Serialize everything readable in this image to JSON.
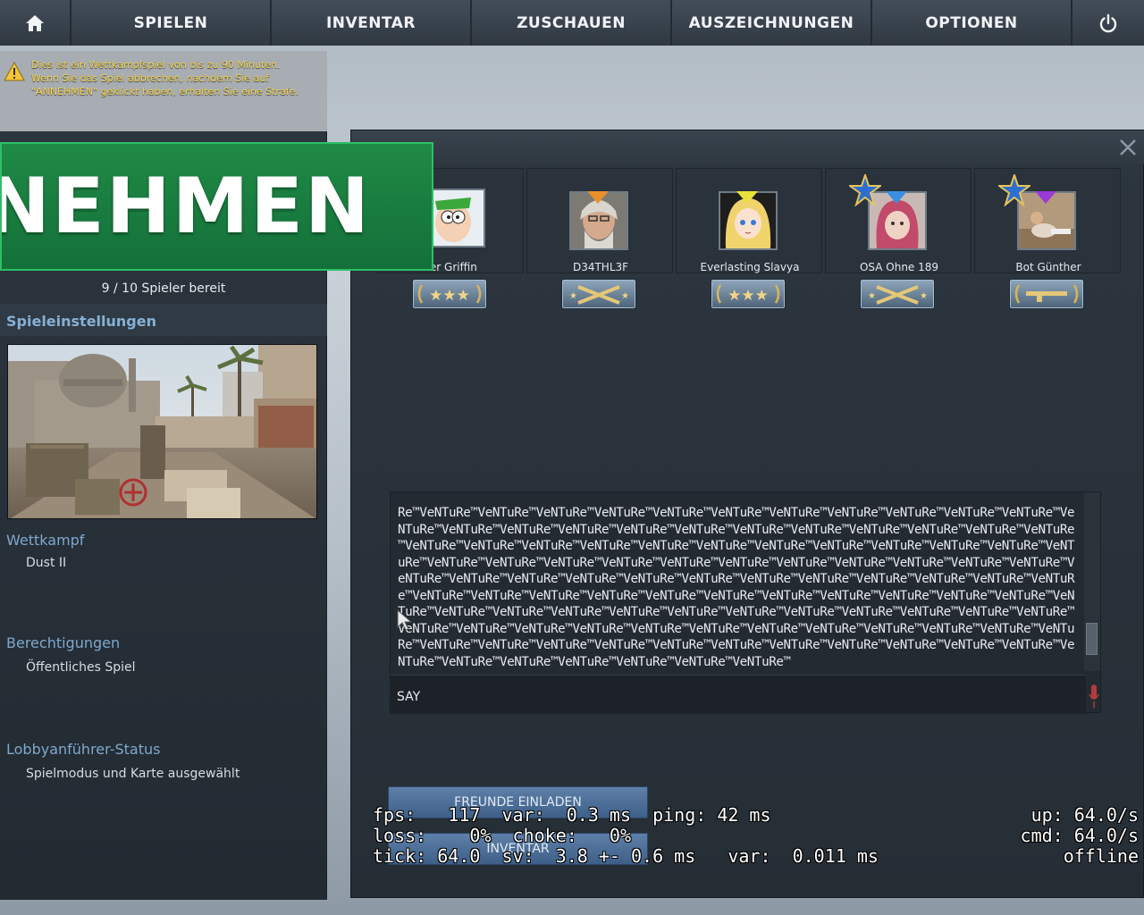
{
  "nav": {
    "tabs": [
      "SPIELEN",
      "INVENTAR",
      "ZUSCHAUEN",
      "AUSZEICHNUNGEN",
      "OPTIONEN"
    ]
  },
  "warning": {
    "text": "Dies ist ein Wettkampfspiel von bis zu 90 Minuten.\nWenn Sie das Spiel abbrechen, nachdem Sie auf\n\"ANNEHMEN\" geklickt haben, erhalten Sie eine Strafe."
  },
  "accept_label": "ANNEHMEN",
  "ready_count": "9 / 10 Spieler bereit",
  "left": {
    "settings_title": "Spieleinstellungen",
    "mode_title": "Wettkampf",
    "map_name": "Dust II",
    "permissions_title": "Berechtigungen",
    "permissions_value": "Öffentliches Spiel",
    "leader_title": "Lobbyanführer-Status",
    "leader_value": "Spielmodus und Karte ausgewählt"
  },
  "players": [
    {
      "name": "ter Griffin"
    },
    {
      "name": "D34THL3F"
    },
    {
      "name": "Everlasting Slavya"
    },
    {
      "name": "OSA Ohne 189"
    },
    {
      "name": "Bot Günther"
    }
  ],
  "chat": {
    "text": "Re™VeNTuRe™VeNTuRe™VeNTuRe™VeNTuRe™VeNTuRe™VeNTuRe™VeNTuRe™VeNTuRe™VeNTuRe™VeNTuRe™VeNTuRe™VeNTuRe™VeNTuRe™VeNTuRe™VeNTuRe™VeNTuRe™VeNTuRe™VeNTuRe™VeNTuRe™VeNTuRe™VeNTuRe™VeNTuRe™VeNTuRe™VeNTuRe™VeNTuRe™VeNTuRe™VeNTuRe™VeNTuRe™VeNTuRe™VeNTuRe™VeNTuRe™VeNTuRe™VeNTuRe™VeNTuRe™VeNTuRe™VeNTuRe™VeNTuRe™VeNTuRe™VeNTuRe™VeNTuRe™VeNTuRe™VeNTuRe™VeNTuRe™VeNTuRe™VeNTuRe™VeNTuRe™VeNTuRe™VeNTuRe™VeNTuRe™VeNTuRe™VeNTuRe™VeNTuRe™VeNTuRe™VeNTuRe™VeNTuRe™VeNTuRe™VeNTuRe™VeNTuRe™VeNTuRe™VeNTuRe™VeNTuRe™VeNTuRe™VeNTuRe™VeNTuRe™VeNTuRe™VeNTuRe™VeNTuRe™VeNTuRe™VeNTuRe™VeNTuRe™VeNTuRe™VeNTuRe™VeNTuRe™VeNTuRe™VeNTuRe™VeNTuRe™VeNTuRe™VeNTuRe™VeNTuRe™VeNTuRe™VeNTuRe™VeNTuRe™VeNTuRe™VeNTuRe™VeNTuRe™VeNTuRe™VeNTuRe™VeNTuRe™VeNTuRe™VeNTuRe™VeNTuRe™VeNTuRe™VeNTuRe™VeNTuRe™VeNTuRe™VeNTuRe™VeNTuRe™VeNTuRe™VeNTuRe™VeNTuRe™VeNTuRe™VeNTuRe™VeNTuRe™VeNTuRe™VeNTuRe™VeNTuRe™VeNTuRe™VeNTuRe™VeNTuRe™VeNTuRe™VeNTuRe™",
    "say_label": "SAY"
  },
  "buttons": {
    "invite": "FREUNDE EINLADEN",
    "inventory": "INVENTAR"
  },
  "netgraph": {
    "left": "fps:   117  var:  0.3 ms  ping: 42 ms\nloss:    0%  choke:   0%\ntick: 64.0  sv:  3.8 +- 0.6 ms   var:  0.011 ms",
    "right": "up: 64.0/s\ncmd: 64.0/s\noffline"
  },
  "colors": {
    "accept_green": "#1f8a45",
    "section_blue": "#7fa8cc",
    "warning_yellow": "#f5d24a"
  }
}
